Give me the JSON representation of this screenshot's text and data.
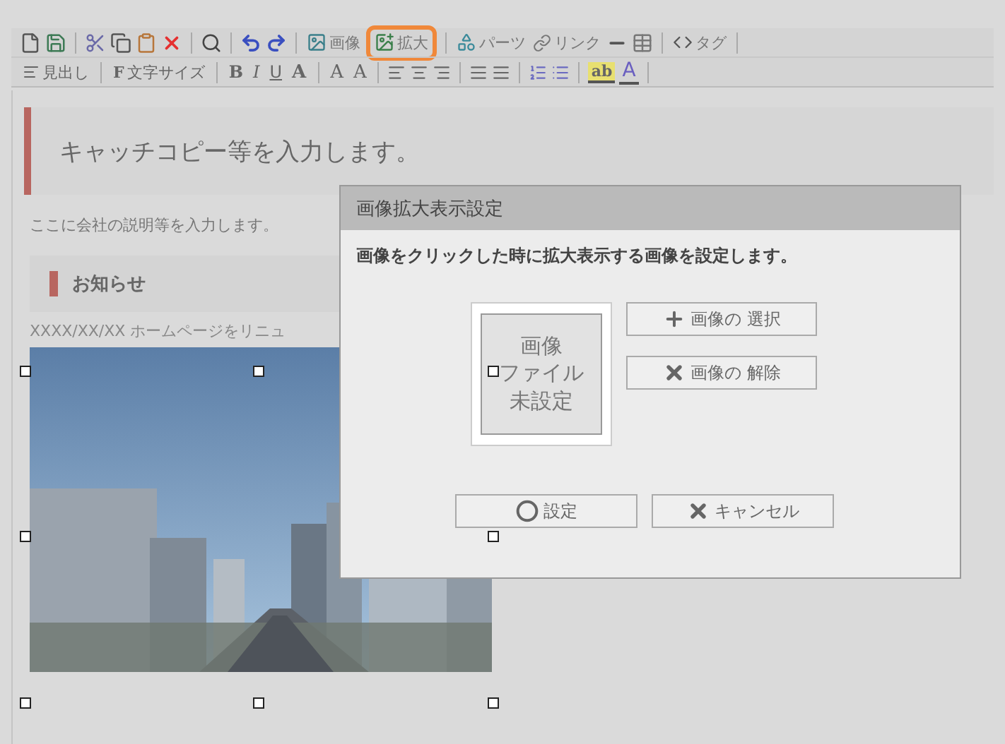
{
  "toolbar_top": [
    {
      "label": "画像",
      "highlighted": false
    },
    {
      "label": "拡大",
      "highlighted": true
    },
    {
      "label": "パーツ",
      "highlighted": false
    },
    {
      "label": "リンク",
      "highlighted": false
    },
    {
      "label": "タグ",
      "highlighted": false
    }
  ],
  "toolbar_format": [
    {
      "kind": "text",
      "label": "見出し"
    },
    {
      "kind": "text",
      "label": "文字サイズ",
      "icon_label": "F"
    },
    {
      "kind": "bold",
      "label": "B"
    },
    {
      "kind": "italic",
      "label": "I"
    },
    {
      "kind": "underline",
      "label": "U"
    },
    {
      "kind": "ruby",
      "label": "A"
    },
    {
      "kind": "sub",
      "label": "A"
    },
    {
      "kind": "sup",
      "label": "A"
    },
    {
      "kind": "highlight",
      "label": "ab"
    },
    {
      "kind": "color",
      "label": "A"
    }
  ],
  "page": {
    "catch_copy": "キャッチコピー等を入力します。",
    "description": "ここに会社の説明等を入力します。",
    "section_title": "お知らせ",
    "news_item": "XXXX/XX/XX ホームページをリニュ",
    "image": {
      "kind": "picture",
      "selected": true
    }
  },
  "dialog": {
    "title": "画像拡大表示設定",
    "message": "画像をクリックした時に拡大表示する画像を設定します。",
    "placeholder_lines": [
      "画像",
      "ファイル",
      "未設定"
    ],
    "side_buttons": [
      "画像の 選択",
      "画像の 解除"
    ],
    "footer_buttons": [
      "設定",
      "キャンセル"
    ]
  }
}
